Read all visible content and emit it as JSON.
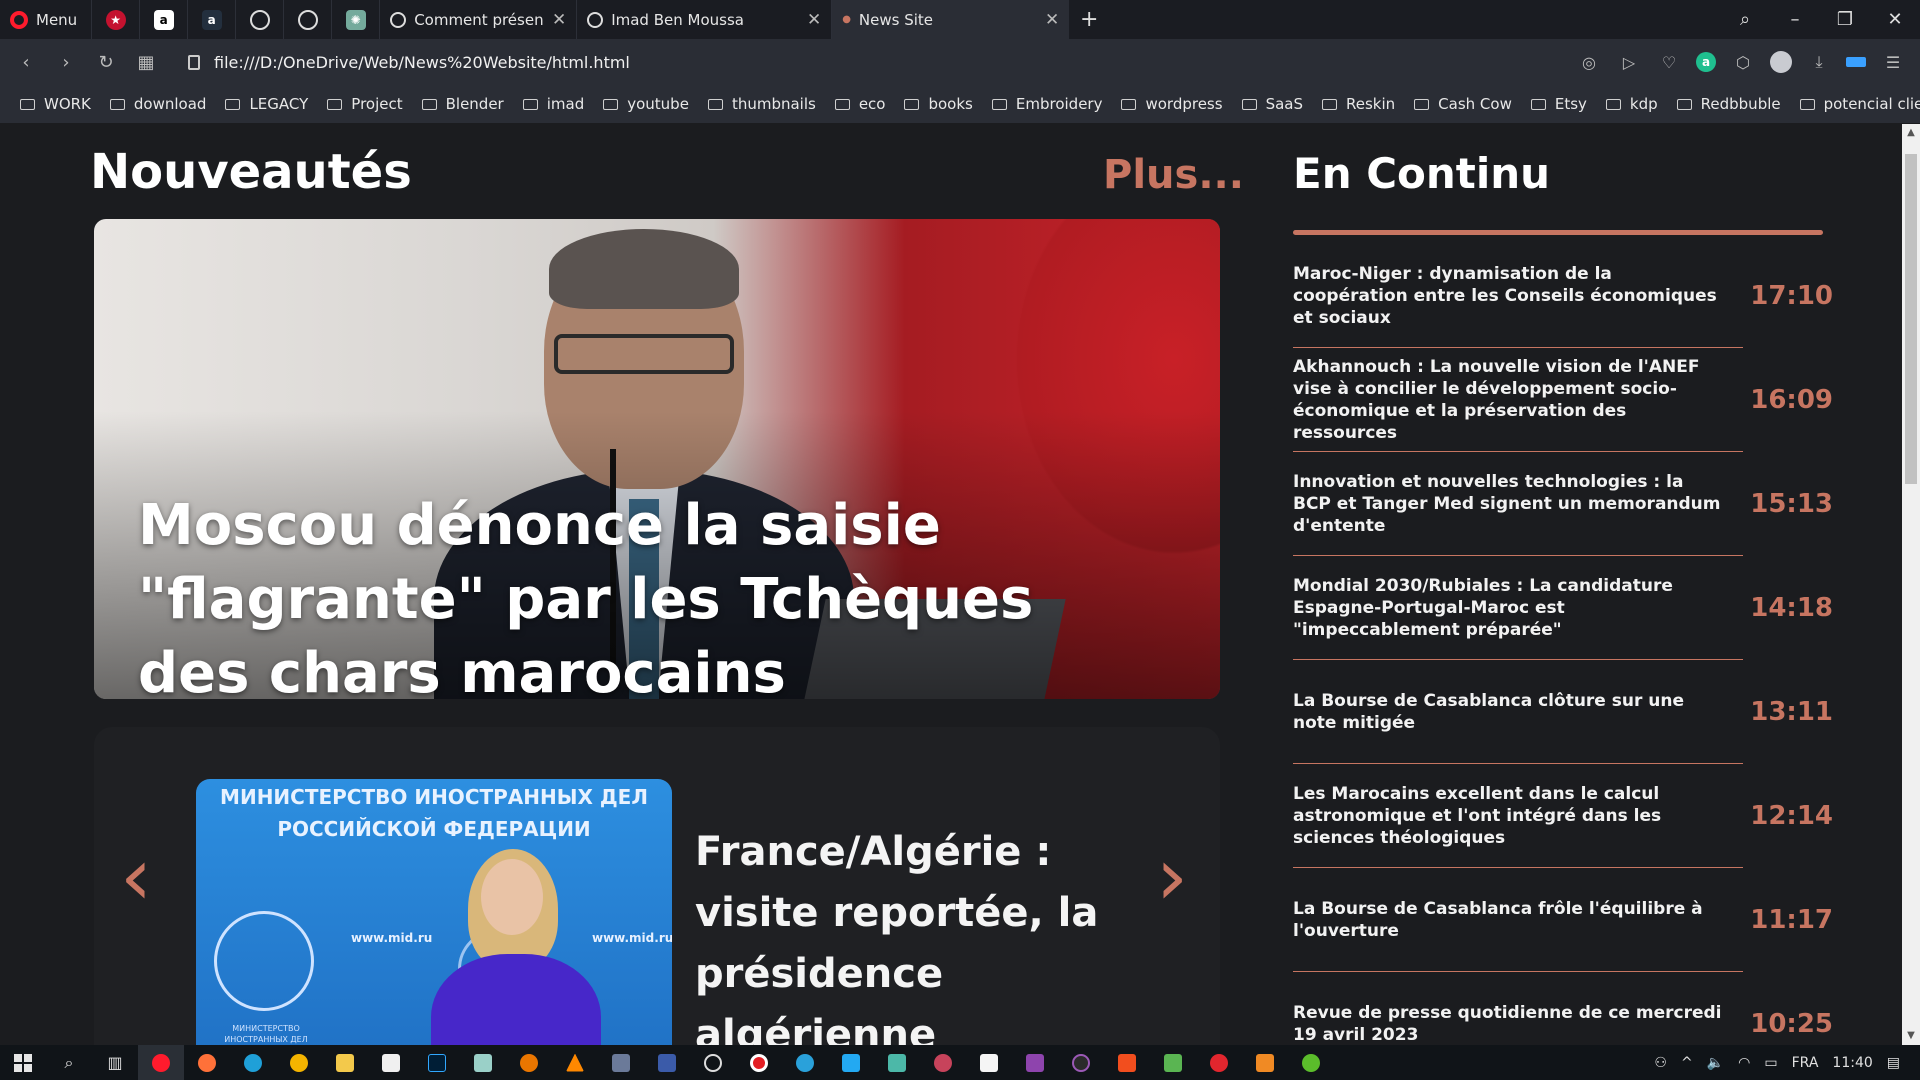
{
  "browser": {
    "menu_label": "Menu",
    "tabs": [
      {
        "title": "Comment présenter un pro",
        "active": false
      },
      {
        "title": "Imad Ben Moussa",
        "active": false
      },
      {
        "title": "News Site",
        "active": true
      }
    ],
    "url": "file:///D:/OneDrive/Web/News%20Website/html.html",
    "bookmarks": [
      "WORK",
      "download",
      "LEGACY",
      "Project",
      "Blender",
      "imad",
      "youtube",
      "thumbnails",
      "eco",
      "books",
      "Embroidery",
      "wordpress",
      "SaaS",
      "Reskin",
      "Cash Cow",
      "Etsy",
      "kdp",
      "Redbbuble",
      "potencial client"
    ]
  },
  "main": {
    "section_title": "Nouveautés",
    "more_link": "Plus...",
    "hero": {
      "headline": "Moscou dénonce la saisie \"flagrante\" par les Tchèques des chars marocains"
    },
    "carousel": {
      "image_banner": "МИНИСТЕРСТВО ИНОСТРАННЫХ ДЕЛ РОССИЙСКОЙ ФЕДЕРАЦИИ",
      "image_url_text": "www.mid.ru",
      "emblem_text": "МИНИСТЕРСТВО ИНОСТРАННЫХ ДЕЛ РОССИЙСКОЙ ФЕДЕРАЦИИ",
      "title": "France/Algérie : visite reportée, la présidence algérienne désenchante..."
    }
  },
  "sidebar": {
    "title": "En Continu",
    "items": [
      {
        "headline": "Maroc-Niger : dynamisation de la coopération entre les Conseils économiques et sociaux",
        "time": "17:10"
      },
      {
        "headline": "Akhannouch : La nouvelle vision de l'ANEF vise à concilier le développement socio-économique et la préservation des ressources",
        "time": "16:09"
      },
      {
        "headline": "Innovation et nouvelles technologies : la BCP et Tanger Med signent un memorandum d'entente",
        "time": "15:13"
      },
      {
        "headline": "Mondial 2030/Rubiales : La candidature Espagne-Portugal-Maroc est \"impeccablement préparée\"",
        "time": "14:18"
      },
      {
        "headline": "La Bourse de Casablanca clôture sur une note mitigée",
        "time": "13:11"
      },
      {
        "headline": "Les Marocains excellent dans le calcul astronomique et l'ont intégré dans les sciences théologiques",
        "time": "12:14"
      },
      {
        "headline": "La Bourse de Casablanca frôle l'équilibre à l'ouverture",
        "time": "11:17"
      },
      {
        "headline": "Revue de presse quotidienne de ce mercredi 19 avril 2023",
        "time": "10:25"
      }
    ]
  },
  "taskbar": {
    "language": "FRA",
    "clock": "11:40"
  },
  "colors": {
    "accent": "#c77561",
    "page_bg": "#1b1c1f",
    "text": "#ffffff"
  }
}
